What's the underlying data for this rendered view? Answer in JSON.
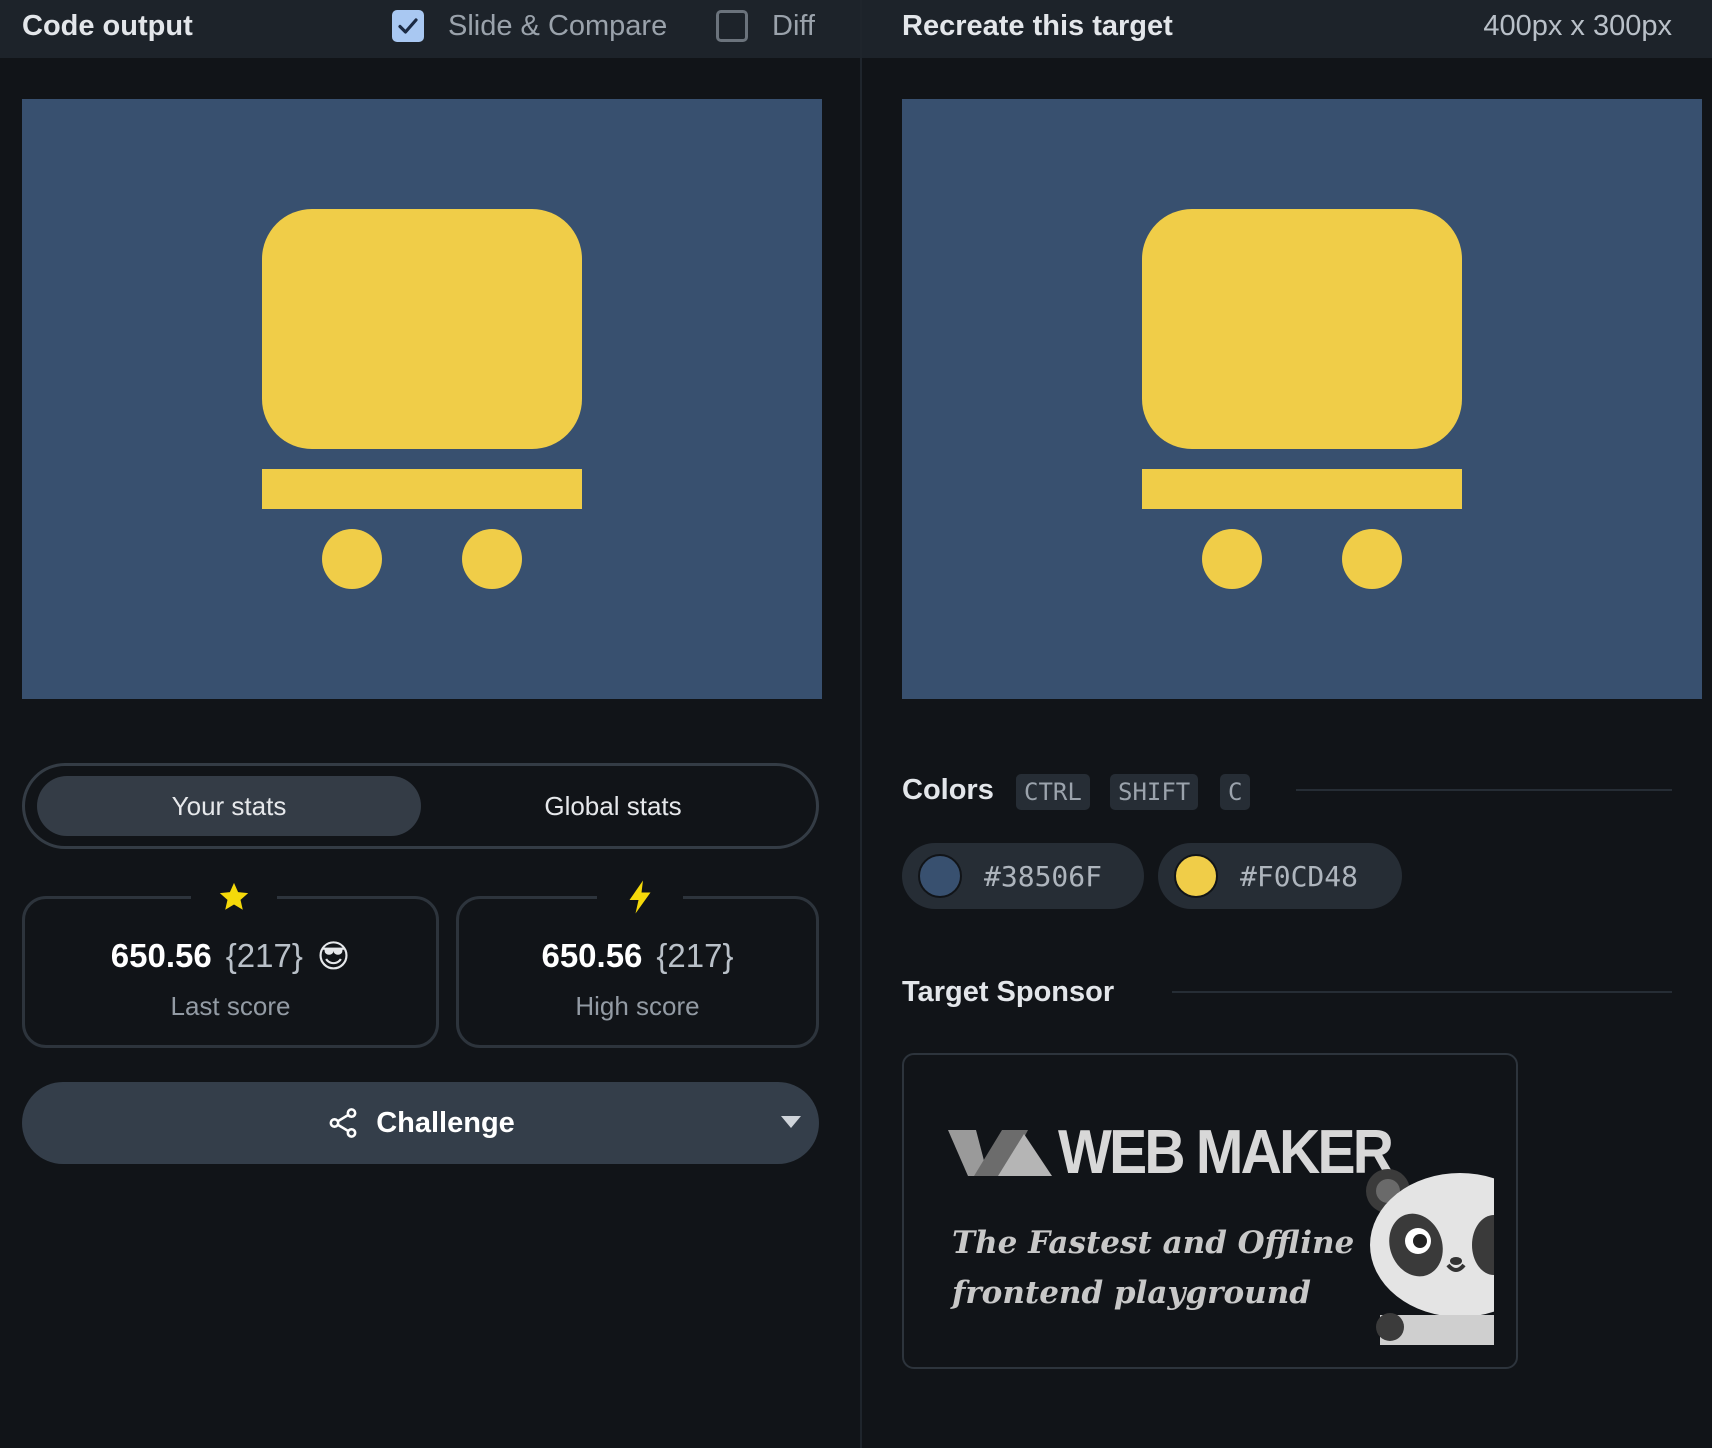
{
  "left_panel": {
    "title": "Code output",
    "slide_compare": {
      "label": "Slide & Compare",
      "checked": true
    },
    "diff": {
      "label": "Diff",
      "checked": false
    }
  },
  "canvas_colors": {
    "background": "#38506F",
    "foreground": "#F0CD48"
  },
  "stats": {
    "tabs": [
      "Your stats",
      "Global stats"
    ],
    "active_tab": "Your stats",
    "last": {
      "icon": "star-icon",
      "score": "650.56",
      "matches": "{217}",
      "emoji": "😎",
      "label": "Last score"
    },
    "high": {
      "icon": "lightning-icon",
      "score": "650.56",
      "matches": "{217}",
      "label": "High score"
    }
  },
  "challenge": {
    "label": "Challenge",
    "icon": "share-icon"
  },
  "right_panel": {
    "title": "Recreate this target",
    "size": "400px x 300px"
  },
  "colors_section": {
    "title": "Colors",
    "shortcut": [
      "CTRL",
      "SHIFT",
      "C"
    ],
    "swatches": [
      {
        "hex": "#38506F"
      },
      {
        "hex": "#F0CD48"
      }
    ]
  },
  "sponsor": {
    "title": "Target Sponsor",
    "logo_text": "WEB MAKER",
    "tagline_line1": "The Fastest and Offline",
    "tagline_line2": "frontend playground"
  }
}
